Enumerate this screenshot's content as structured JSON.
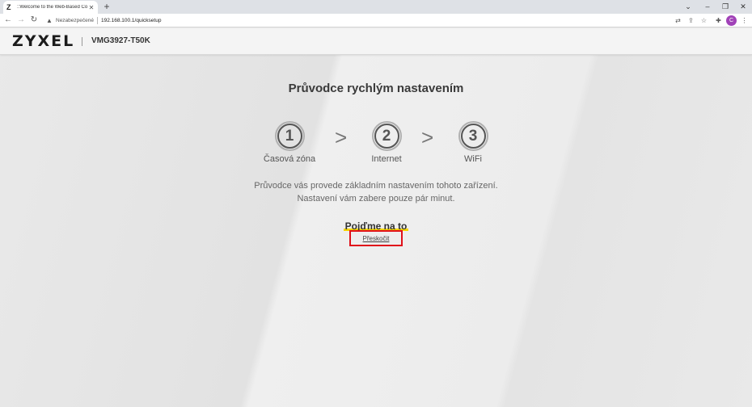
{
  "browser": {
    "tab_title": "::Welcome to the Web-Based Co",
    "security_label": "Nezabezpečené",
    "url": "192.168.100.1/quicksetup",
    "profile_initial": "C"
  },
  "header": {
    "brand": "ZYXEL",
    "model": "VMG3927-T50K"
  },
  "wizard": {
    "title": "Průvodce rychlým nastavením",
    "steps": [
      {
        "number": "1",
        "label": "Časová zóna"
      },
      {
        "number": "2",
        "label": "Internet"
      },
      {
        "number": "3",
        "label": "WiFi"
      }
    ],
    "arrow_symbol": ">",
    "intro_line1": "Průvodce vás provede základním nastavením tohoto zařízení.",
    "intro_line2": "Nastavení vám zabere pouze pár minut.",
    "start_label": "Pojďme na to",
    "skip_label": "Přeskočit"
  }
}
